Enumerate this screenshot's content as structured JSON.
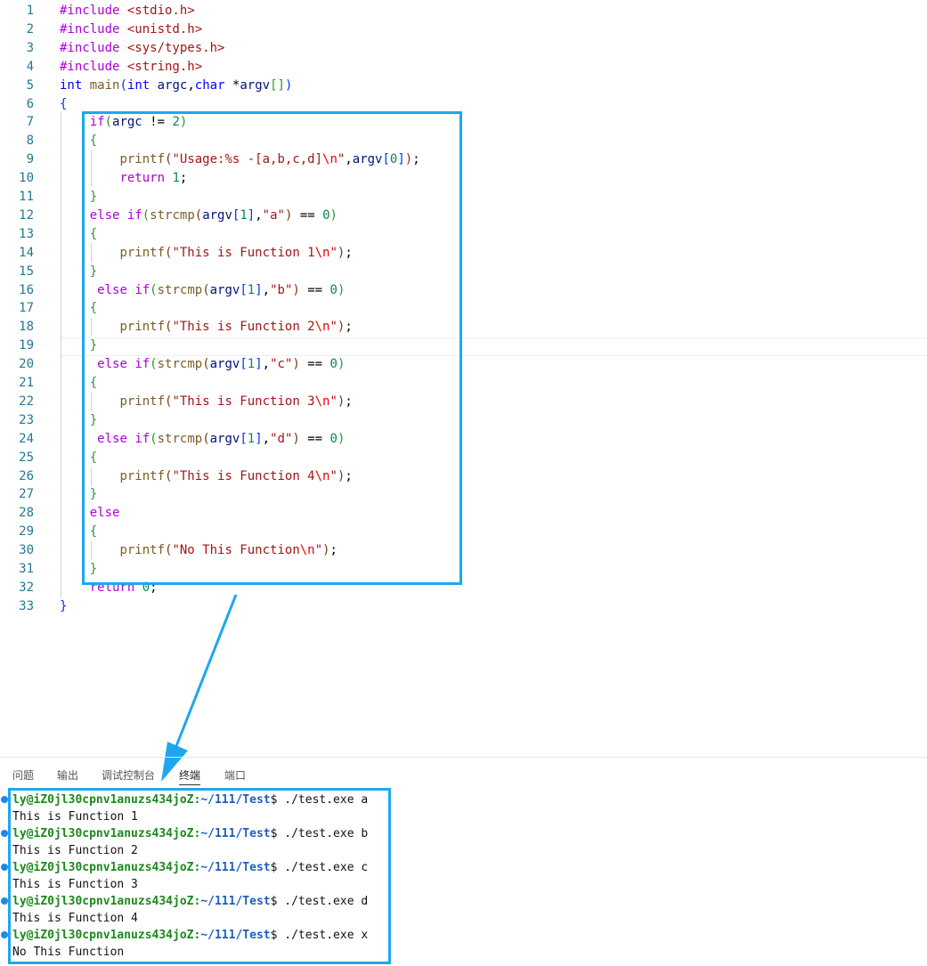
{
  "editor": {
    "code": [
      {
        "n": "1",
        "t": [
          [
            "pp",
            "#include "
          ],
          [
            "s",
            "<stdio.h>"
          ]
        ]
      },
      {
        "n": "2",
        "t": [
          [
            "pp",
            "#include "
          ],
          [
            "s",
            "<unistd.h>"
          ]
        ]
      },
      {
        "n": "3",
        "t": [
          [
            "pp",
            "#include "
          ],
          [
            "s",
            "<sys/types.h>"
          ]
        ]
      },
      {
        "n": "4",
        "t": [
          [
            "pp",
            "#include "
          ],
          [
            "s",
            "<string.h>"
          ]
        ]
      },
      {
        "n": "5",
        "t": [
          [
            "k",
            "int"
          ],
          [
            "p",
            " "
          ],
          [
            "f",
            "main"
          ],
          [
            "b1",
            "("
          ],
          [
            "k",
            "int"
          ],
          [
            "p",
            " "
          ],
          [
            "v",
            "argc"
          ],
          [
            "p",
            ","
          ],
          [
            "k",
            "char"
          ],
          [
            "p",
            " *"
          ],
          [
            "v",
            "argv"
          ],
          [
            "b2",
            "[]"
          ],
          [
            "b1",
            ")"
          ]
        ]
      },
      {
        "n": "6",
        "t": [
          [
            "b1",
            "{"
          ]
        ]
      },
      {
        "n": "7",
        "t": [
          [
            "p",
            "    "
          ],
          [
            "c",
            "if"
          ],
          [
            "b2",
            "("
          ],
          [
            "v",
            "argc"
          ],
          [
            "p",
            " != "
          ],
          [
            "n",
            "2"
          ],
          [
            "b2",
            ")"
          ]
        ]
      },
      {
        "n": "8",
        "t": [
          [
            "p",
            "    "
          ],
          [
            "b2",
            "{"
          ]
        ]
      },
      {
        "n": "9",
        "t": [
          [
            "p",
            "        "
          ],
          [
            "f",
            "printf"
          ],
          [
            "b3",
            "("
          ],
          [
            "s",
            "\"Usage:%s -[a,b,c,d]"
          ],
          [
            "e",
            "\\n"
          ],
          [
            "s",
            "\""
          ],
          [
            "p",
            ","
          ],
          [
            "v",
            "argv"
          ],
          [
            "b1",
            "["
          ],
          [
            "n",
            "0"
          ],
          [
            "b1",
            "]"
          ],
          [
            "b3",
            ")"
          ],
          [
            "p",
            ";"
          ]
        ]
      },
      {
        "n": "10",
        "t": [
          [
            "p",
            "        "
          ],
          [
            "c",
            "return"
          ],
          [
            "p",
            " "
          ],
          [
            "n",
            "1"
          ],
          [
            "p",
            ";"
          ]
        ]
      },
      {
        "n": "11",
        "t": [
          [
            "p",
            "    "
          ],
          [
            "b2",
            "}"
          ]
        ]
      },
      {
        "n": "12",
        "t": [
          [
            "p",
            "    "
          ],
          [
            "c",
            "else"
          ],
          [
            "p",
            " "
          ],
          [
            "c",
            "if"
          ],
          [
            "b2",
            "("
          ],
          [
            "f",
            "strcmp"
          ],
          [
            "b3",
            "("
          ],
          [
            "v",
            "argv"
          ],
          [
            "b1",
            "["
          ],
          [
            "n",
            "1"
          ],
          [
            "b1",
            "]"
          ],
          [
            "p",
            ","
          ],
          [
            "s",
            "\"a\""
          ],
          [
            "b3",
            ")"
          ],
          [
            "p",
            " == "
          ],
          [
            "n",
            "0"
          ],
          [
            "b2",
            ")"
          ]
        ]
      },
      {
        "n": "13",
        "t": [
          [
            "p",
            "    "
          ],
          [
            "b2",
            "{"
          ]
        ]
      },
      {
        "n": "14",
        "t": [
          [
            "p",
            "        "
          ],
          [
            "f",
            "printf"
          ],
          [
            "b3",
            "("
          ],
          [
            "s",
            "\"This is Function 1"
          ],
          [
            "e",
            "\\n"
          ],
          [
            "s",
            "\""
          ],
          [
            "b3",
            ")"
          ],
          [
            "p",
            ";"
          ]
        ]
      },
      {
        "n": "15",
        "t": [
          [
            "p",
            "    "
          ],
          [
            "b2",
            "}"
          ]
        ]
      },
      {
        "n": "16",
        "t": [
          [
            "p",
            "     "
          ],
          [
            "c",
            "else"
          ],
          [
            "p",
            " "
          ],
          [
            "c",
            "if"
          ],
          [
            "b2",
            "("
          ],
          [
            "f",
            "strcmp"
          ],
          [
            "b3",
            "("
          ],
          [
            "v",
            "argv"
          ],
          [
            "b1",
            "["
          ],
          [
            "n",
            "1"
          ],
          [
            "b1",
            "]"
          ],
          [
            "p",
            ","
          ],
          [
            "s",
            "\"b\""
          ],
          [
            "b3",
            ")"
          ],
          [
            "p",
            " == "
          ],
          [
            "n",
            "0"
          ],
          [
            "b2",
            ")"
          ]
        ]
      },
      {
        "n": "17",
        "t": [
          [
            "p",
            "    "
          ],
          [
            "b2",
            "{"
          ]
        ]
      },
      {
        "n": "18",
        "t": [
          [
            "p",
            "        "
          ],
          [
            "f",
            "printf"
          ],
          [
            "b3",
            "("
          ],
          [
            "s",
            "\"This is Function 2"
          ],
          [
            "e",
            "\\n"
          ],
          [
            "s",
            "\""
          ],
          [
            "b3",
            ")"
          ],
          [
            "p",
            ";"
          ]
        ]
      },
      {
        "n": "19",
        "t": [
          [
            "p",
            "    "
          ],
          [
            "b2",
            "}"
          ]
        ]
      },
      {
        "n": "20",
        "t": [
          [
            "p",
            "     "
          ],
          [
            "c",
            "else"
          ],
          [
            "p",
            " "
          ],
          [
            "c",
            "if"
          ],
          [
            "b2",
            "("
          ],
          [
            "f",
            "strcmp"
          ],
          [
            "b3",
            "("
          ],
          [
            "v",
            "argv"
          ],
          [
            "b1",
            "["
          ],
          [
            "n",
            "1"
          ],
          [
            "b1",
            "]"
          ],
          [
            "p",
            ","
          ],
          [
            "s",
            "\"c\""
          ],
          [
            "b3",
            ")"
          ],
          [
            "p",
            " == "
          ],
          [
            "n",
            "0"
          ],
          [
            "b2",
            ")"
          ]
        ]
      },
      {
        "n": "21",
        "t": [
          [
            "p",
            "    "
          ],
          [
            "b2",
            "{"
          ]
        ]
      },
      {
        "n": "22",
        "t": [
          [
            "p",
            "        "
          ],
          [
            "f",
            "printf"
          ],
          [
            "b3",
            "("
          ],
          [
            "s",
            "\"This is Function 3"
          ],
          [
            "e",
            "\\n"
          ],
          [
            "s",
            "\""
          ],
          [
            "b3",
            ")"
          ],
          [
            "p",
            ";"
          ]
        ]
      },
      {
        "n": "23",
        "t": [
          [
            "p",
            "    "
          ],
          [
            "b2",
            "}"
          ]
        ]
      },
      {
        "n": "24",
        "t": [
          [
            "p",
            "     "
          ],
          [
            "c",
            "else"
          ],
          [
            "p",
            " "
          ],
          [
            "c",
            "if"
          ],
          [
            "b2",
            "("
          ],
          [
            "f",
            "strcmp"
          ],
          [
            "b3",
            "("
          ],
          [
            "v",
            "argv"
          ],
          [
            "b1",
            "["
          ],
          [
            "n",
            "1"
          ],
          [
            "b1",
            "]"
          ],
          [
            "p",
            ","
          ],
          [
            "s",
            "\"d\""
          ],
          [
            "b3",
            ")"
          ],
          [
            "p",
            " == "
          ],
          [
            "n",
            "0"
          ],
          [
            "b2",
            ")"
          ]
        ]
      },
      {
        "n": "25",
        "t": [
          [
            "p",
            "    "
          ],
          [
            "b2",
            "{"
          ]
        ]
      },
      {
        "n": "26",
        "t": [
          [
            "p",
            "        "
          ],
          [
            "f",
            "printf"
          ],
          [
            "b3",
            "("
          ],
          [
            "s",
            "\"This is Function 4"
          ],
          [
            "e",
            "\\n"
          ],
          [
            "s",
            "\""
          ],
          [
            "b3",
            ")"
          ],
          [
            "p",
            ";"
          ]
        ]
      },
      {
        "n": "27",
        "t": [
          [
            "p",
            "    "
          ],
          [
            "b2",
            "}"
          ]
        ]
      },
      {
        "n": "28",
        "t": [
          [
            "p",
            "    "
          ],
          [
            "c",
            "else"
          ]
        ]
      },
      {
        "n": "29",
        "t": [
          [
            "p",
            "    "
          ],
          [
            "b2",
            "{"
          ]
        ]
      },
      {
        "n": "30",
        "t": [
          [
            "p",
            "        "
          ],
          [
            "f",
            "printf"
          ],
          [
            "b3",
            "("
          ],
          [
            "s",
            "\"No This Function"
          ],
          [
            "e",
            "\\n"
          ],
          [
            "s",
            "\""
          ],
          [
            "b3",
            ")"
          ],
          [
            "p",
            ";"
          ]
        ]
      },
      {
        "n": "31",
        "t": [
          [
            "p",
            "    "
          ],
          [
            "b2",
            "}"
          ]
        ]
      },
      {
        "n": "32",
        "t": [
          [
            "p",
            "    "
          ],
          [
            "c",
            "return"
          ],
          [
            "p",
            " "
          ],
          [
            "n",
            "0"
          ],
          [
            "p",
            ";"
          ]
        ]
      },
      {
        "n": "33",
        "t": [
          [
            "b1",
            "}"
          ]
        ]
      }
    ]
  },
  "panel": {
    "tabs": [
      "问题",
      "输出",
      "调试控制台",
      "终端",
      "端口"
    ],
    "active_tab": "终端"
  },
  "terminal": {
    "user_host": "ly@iZ0jl30cpnv1anuzs434joZ",
    "sep": ":",
    "path": "~/111/Test",
    "prompt_end": "$ ",
    "sessions": [
      {
        "cmd": "./test.exe a",
        "out": "This is Function 1"
      },
      {
        "cmd": "./test.exe b",
        "out": "This is Function 2"
      },
      {
        "cmd": "./test.exe c",
        "out": "This is Function 3"
      },
      {
        "cmd": "./test.exe d",
        "out": "This is Function 4"
      },
      {
        "cmd": "./test.exe x",
        "out": "No This Function"
      }
    ]
  },
  "colors": {
    "highlight_box": "#1ea7f0",
    "line_number": "#237893",
    "keyword": "#0000ff",
    "control": "#af00db",
    "string": "#a31515",
    "number": "#098658",
    "terminal_user": "#1a8a1a",
    "terminal_path": "#1b5fc0"
  }
}
